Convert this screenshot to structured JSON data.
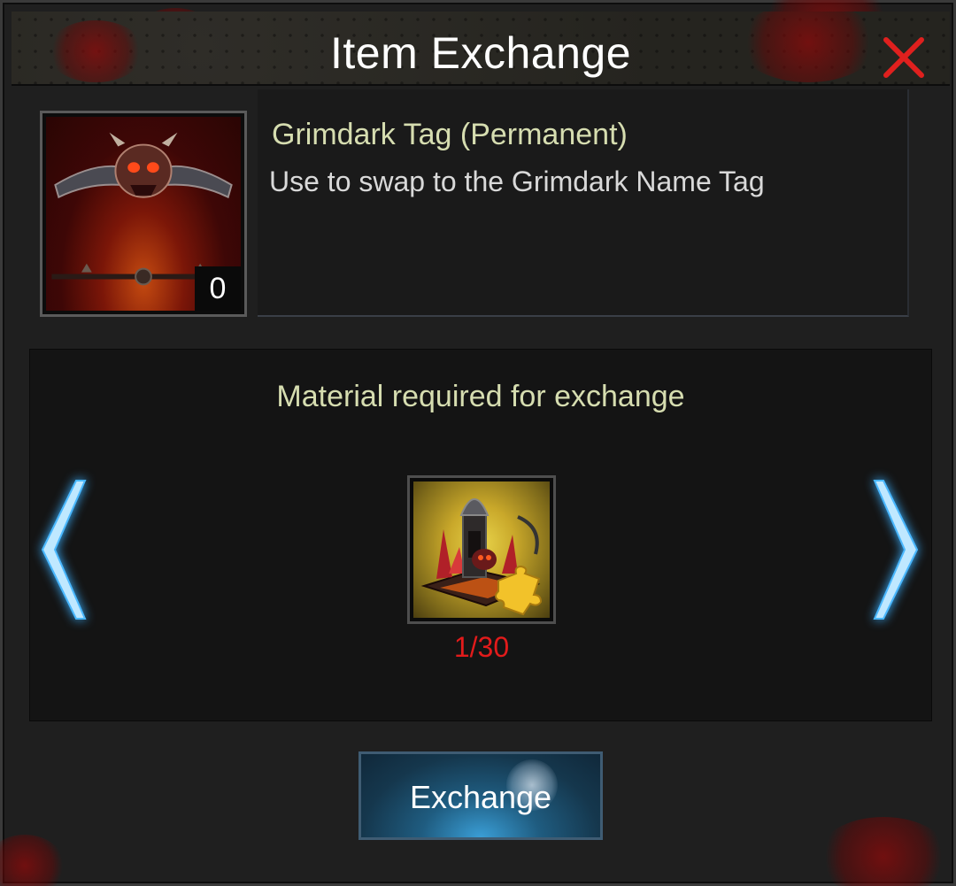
{
  "dialog": {
    "title": "Item Exchange",
    "close_icon": "close-icon",
    "accent_color": "#e0201e"
  },
  "item": {
    "name": "Grimdark Tag (Permanent)",
    "description": "Use to swap to the Grimdark Name Tag",
    "count": "0",
    "icon": "grimdark-name-tag-icon",
    "name_color": "#d6ddb0"
  },
  "material": {
    "heading": "Material required for exchange",
    "progress": "1/30",
    "progress_color": "#e21b1b",
    "icon": "building-puzzle-piece-icon",
    "prev_icon": "chevron-left-icon",
    "next_icon": "chevron-right-icon"
  },
  "actions": {
    "exchange_label": "Exchange"
  }
}
